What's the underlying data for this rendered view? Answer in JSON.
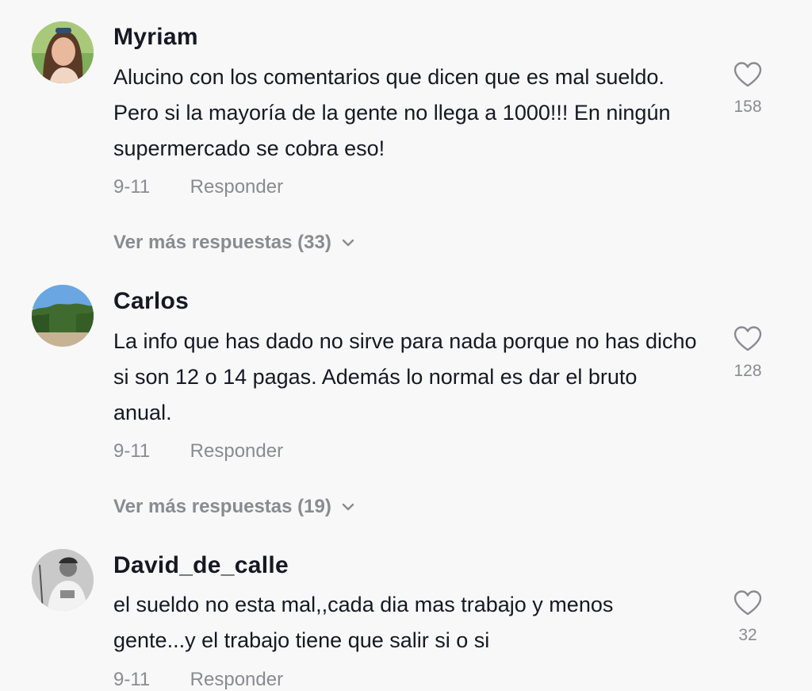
{
  "comments": [
    {
      "username": "Myriam",
      "text": "Alucino con los comentarios que dicen que es mal sueldo. Pero si la mayoría de la gente no llega a 1000!!! En ningún supermercado se cobra eso!",
      "date": "9-11",
      "reply": "Responder",
      "likes": "158",
      "more_replies": "Ver más respuestas (33)"
    },
    {
      "username": "Carlos",
      "text": "La info que has dado no sirve para nada porque no has dicho si son 12 o 14 pagas. Además lo normal es dar el bruto anual.",
      "date": "9-11",
      "reply": "Responder",
      "likes": "128",
      "more_replies": "Ver más respuestas (19)"
    },
    {
      "username": "David_de_calle",
      "text": "el sueldo no esta mal,,cada dia mas trabajo y menos gente...y el trabajo tiene que salir si o si",
      "date": "9-11",
      "reply": "Responder",
      "likes": "32"
    }
  ],
  "icons": {
    "like": "heart-outline-icon",
    "expand": "chevron-down-icon"
  },
  "colors": {
    "text": "#161823",
    "muted": "#8a8b91",
    "background": "#f8f8f8"
  }
}
